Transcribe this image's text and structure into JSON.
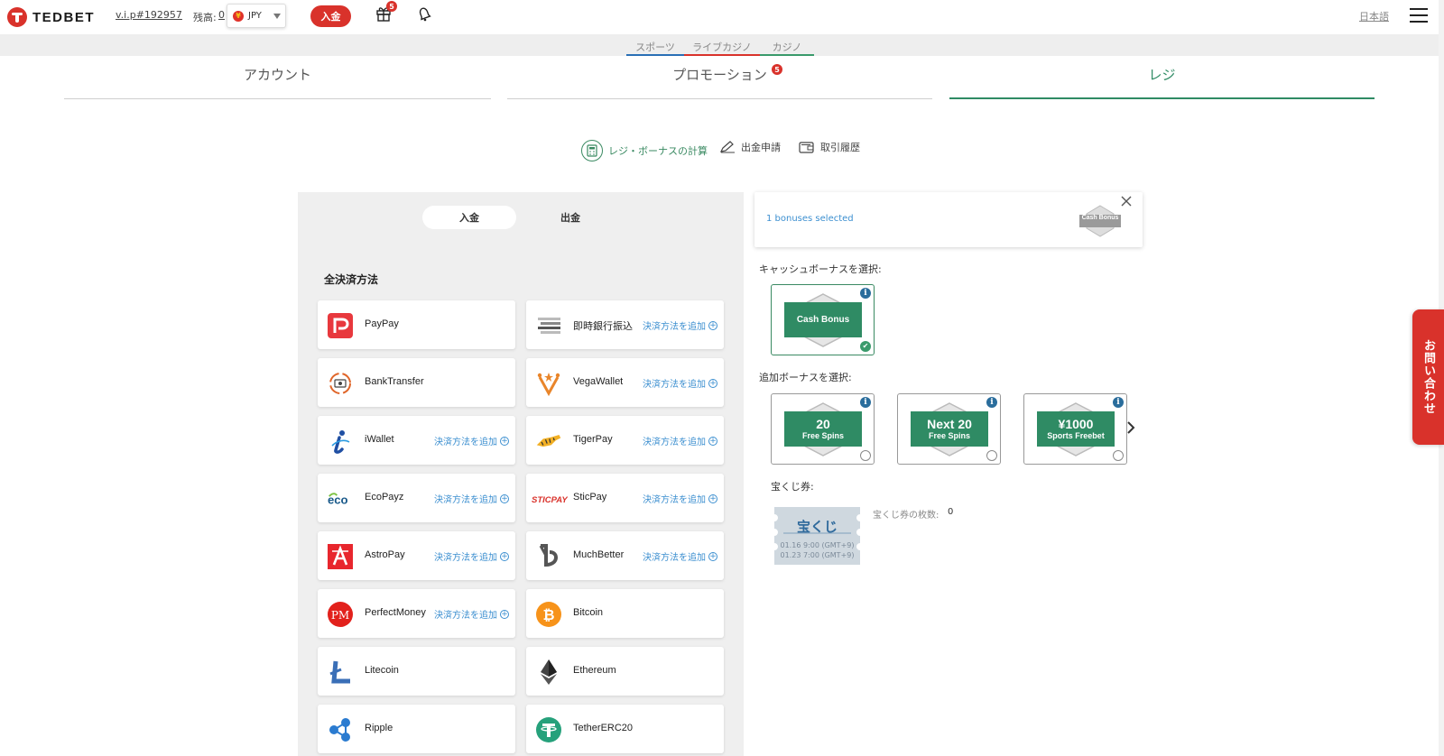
{
  "header": {
    "logo_text": "TEDBET",
    "vip": "v.i.p#192957",
    "balance_label": "残高:",
    "balance_value": "0",
    "currency": "JPY",
    "currency_flag": "¥",
    "deposit_label": "入金",
    "gift_badge": "5",
    "language": "日本語"
  },
  "subnav": {
    "sports": "スポーツ",
    "live_casino": "ライブカジノ",
    "casino": "カジノ"
  },
  "main_tabs": {
    "account": "アカウント",
    "promotion": "プロモーション",
    "promotion_badge": "5",
    "cashier": "レジ"
  },
  "tools": {
    "calculator": "レジ・ボーナスの計算",
    "withdraw_request": "出金申請",
    "history": "取引履歴"
  },
  "cashier": {
    "tab_deposit": "入金",
    "tab_withdraw": "出金",
    "all_methods_title": "全決済方法",
    "add_method_label": "決済方法を追加",
    "methods": [
      {
        "name": "PayPay",
        "icon": "paypay-icon",
        "add": false
      },
      {
        "name": "即時銀行振込",
        "icon": "instant-bank-icon",
        "add": true
      },
      {
        "name": "BankTransfer",
        "icon": "bank-transfer-icon",
        "add": false
      },
      {
        "name": "VegaWallet",
        "icon": "vegawallet-icon",
        "add": true
      },
      {
        "name": "iWallet",
        "icon": "iwallet-icon",
        "add": true
      },
      {
        "name": "TigerPay",
        "icon": "tigerpay-icon",
        "add": true
      },
      {
        "name": "EcoPayz",
        "icon": "ecopayz-icon",
        "add": true
      },
      {
        "name": "SticPay",
        "icon": "sticpay-icon",
        "add": true
      },
      {
        "name": "AstroPay",
        "icon": "astropay-icon",
        "add": true
      },
      {
        "name": "MuchBetter",
        "icon": "muchbetter-icon",
        "add": true
      },
      {
        "name": "PerfectMoney",
        "icon": "perfectmoney-icon",
        "add": true
      },
      {
        "name": "Bitcoin",
        "icon": "bitcoin-icon",
        "add": false
      },
      {
        "name": "Litecoin",
        "icon": "litecoin-icon",
        "add": false
      },
      {
        "name": "Ethereum",
        "icon": "ethereum-icon",
        "add": false
      },
      {
        "name": "Ripple",
        "icon": "ripple-icon",
        "add": false
      },
      {
        "name": "TetherERC20",
        "icon": "tether-icon",
        "add": false
      }
    ]
  },
  "bonus": {
    "selected_text": "1 bonuses selected",
    "mini_label": "Cash Bonus",
    "cash_section": "キャッシュボーナスを選択:",
    "cash_card": "Cash Bonus",
    "extra_section": "追加ボーナスを選択:",
    "extra_cards": [
      {
        "big": "20",
        "small": "Free Spins"
      },
      {
        "big": "Next 20",
        "small": "Free Spins"
      },
      {
        "big": "¥1000",
        "small": "Sports Freebet"
      }
    ],
    "lottery_section": "宝くじ券:",
    "lottery_title": "宝くじ",
    "lottery_line1": "01.16 9:00 (GMT+9)",
    "lottery_line2": "01.23 7:00 (GMT+9)",
    "lottery_count_label": "宝くじ券の枚数:",
    "lottery_count": "0",
    "info_symbol": "i"
  },
  "contact_label": "お問い合わせ",
  "colors": {
    "brand_red": "#d9322b",
    "brand_green": "#2f8b64",
    "link_blue": "#3c8fd0"
  }
}
